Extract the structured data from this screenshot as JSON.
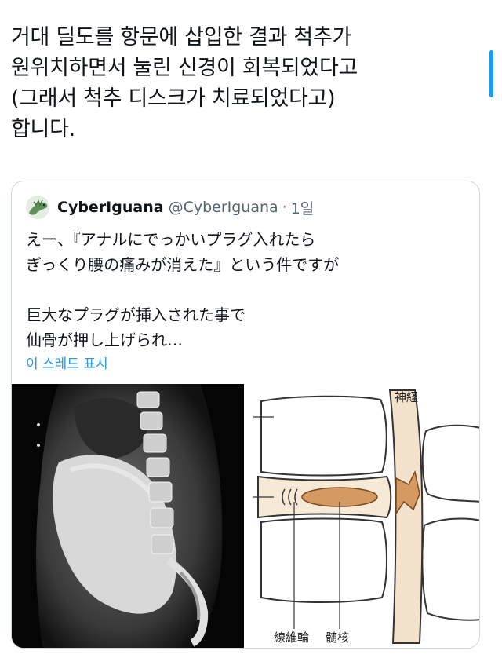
{
  "tweet": {
    "lines": [
      "거대 딜도를 항문에 삽입한 결과 척추가",
      "원위치하면서 눌린 신경이 회복되었다고",
      "(그래서 척추 디스크가 치료되었다고)",
      "합니다."
    ]
  },
  "quote": {
    "display_name": "CyberIguana",
    "handle": "@CyberIguana",
    "separator": "·",
    "time": "1일",
    "body_lines": [
      "えー、『アナルにでっかいプラグ入れたら",
      "ぎっくり腰の痛みが消えた』という件ですが",
      "",
      "巨大なプラグが挿入された事で",
      "仙骨が押し上げられ…"
    ],
    "show_thread": "이 스레드 표시"
  },
  "diagram": {
    "label_nerve": "神経",
    "label_annulus": "線維輪",
    "label_nucleus": "髄核"
  },
  "colors": {
    "link": "#1d9bf0",
    "disc": "#f6ead6",
    "nucleus": "#d59a62",
    "nerve_fill": "#e8c9a0"
  }
}
